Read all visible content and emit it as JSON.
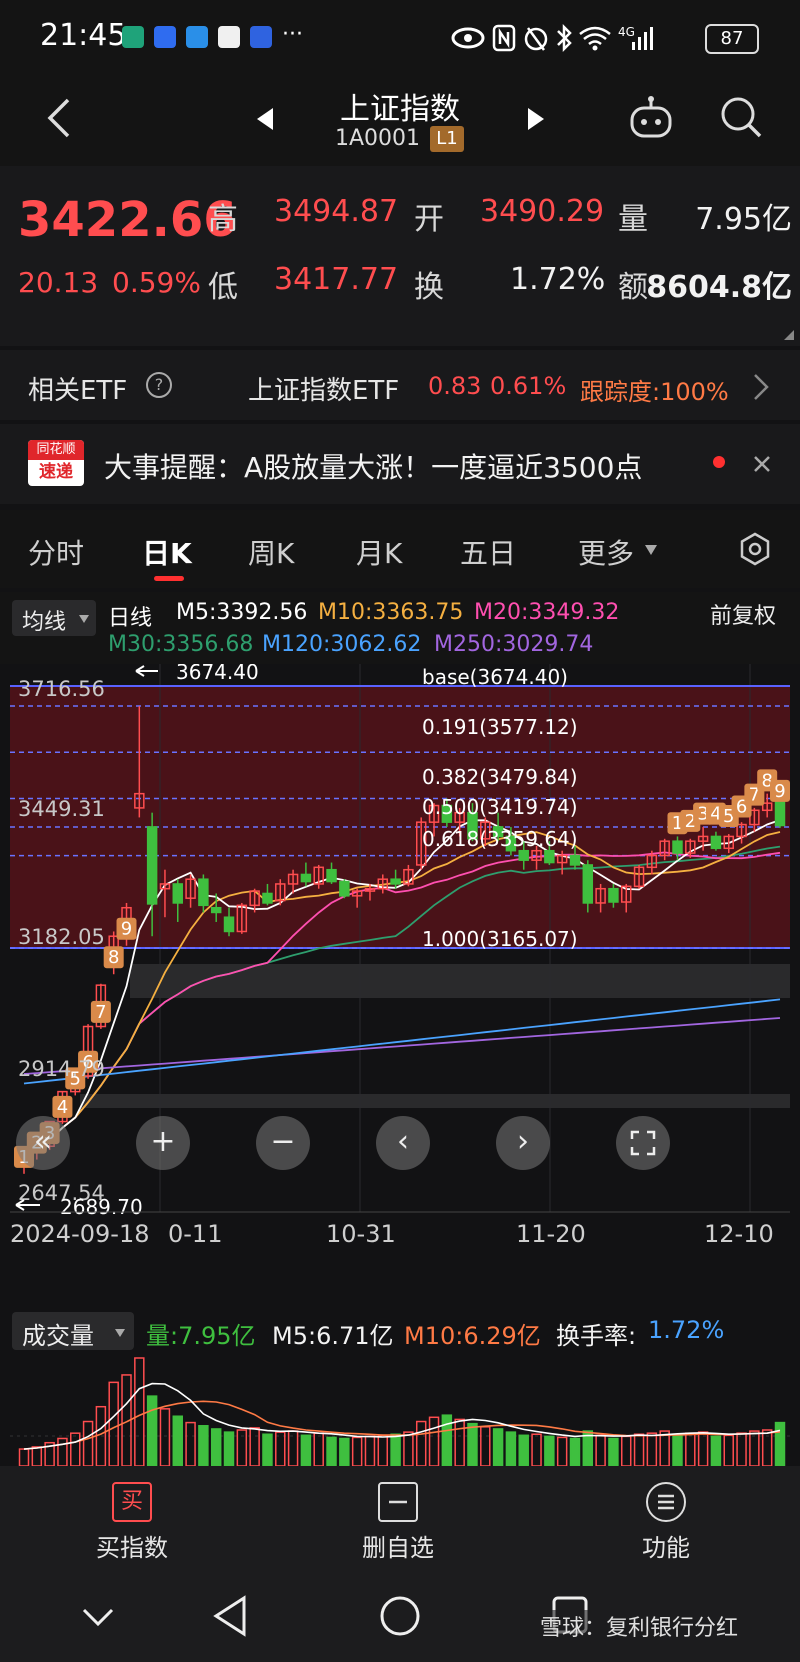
{
  "status_bar": {
    "time": "21:45",
    "dots": "···",
    "network": "4G",
    "battery": "87"
  },
  "nav": {
    "title": "上证指数",
    "code": "1A0001",
    "level_badge": "L1"
  },
  "quote": {
    "price": "3422.66",
    "change": "20.13",
    "change_pct": "0.59%",
    "high_label": "高",
    "high": "3494.87",
    "open_label": "开",
    "open": "3490.29",
    "volume_label": "量",
    "volume": "7.95亿",
    "low_label": "低",
    "low": "3417.77",
    "turnover_label": "换",
    "turnover": "1.72%",
    "amount_label": "额",
    "amount": "8604.8亿"
  },
  "etf": {
    "label": "相关ETF",
    "name": "上证指数ETF",
    "value": "0.83",
    "pct": "0.61%",
    "tracking": "跟踪度:100%"
  },
  "news": {
    "logo_top": "同花顺",
    "logo_bottom": "速递",
    "text": "大事提醒：A股放量大涨！一度逼近3500点"
  },
  "tabs": [
    "分时",
    "日K",
    "周K",
    "月K",
    "五日",
    "更多"
  ],
  "indicators": {
    "ma_selector": "均线",
    "period": "日线",
    "m5": "M5:3392.56",
    "m10": "M10:3363.75",
    "m20": "M20:3349.32",
    "m30": "M30:3356.68",
    "m120": "M120:3062.62",
    "m250": "M250:3029.74",
    "adjust": "前复权"
  },
  "colors": {
    "up": "#ff4d4f",
    "down": "#3fbf3f",
    "m5": "#ffffff",
    "m10": "#f5b041",
    "m20": "#ff4fb0",
    "m30": "#2e9f6e",
    "m120": "#4aa3ff",
    "m250": "#a266e0"
  },
  "chart_labels": {
    "top_price": "3716.56",
    "mid_price": "3449.31",
    "low_band_price": "3182.05",
    "price_2914": "2914.79",
    "bottom_price": "2647.54",
    "max_arrow": "3674.40",
    "min_arrow": "2689.70",
    "fib": [
      "base(3674.40)",
      "0.191(3577.12)",
      "0.382(3479.84)",
      "0.500(3419.74)",
      "0.618(3359.64)",
      "1.000(3165.07)"
    ],
    "dates": [
      "2024-09-18",
      "0-11",
      "10-31",
      "11-20",
      "12-10"
    ],
    "counts_early": [
      "1",
      "2",
      "3",
      "4",
      "5",
      "6",
      "7",
      "8",
      "9"
    ],
    "counts_late": [
      "1",
      "2",
      "3",
      "4",
      "5",
      "6",
      "7",
      "8",
      "9"
    ]
  },
  "chart_controls": {
    "zoom_in": "+",
    "zoom_out": "−",
    "prev": "‹",
    "next": "›"
  },
  "volume": {
    "selector": "成交量",
    "vol": "量:7.95亿",
    "m5": "M5:6.71亿",
    "m10": "M10:6.29亿",
    "turnover_label": "换手率:",
    "turnover": "1.72%"
  },
  "actions": {
    "buy_icon": "买",
    "buy": "买指数",
    "remove": "删自选",
    "func": "功能"
  },
  "watermark": "雪球：复利银行分红",
  "chart_data": {
    "type": "candlestick",
    "period": "日线",
    "x_ticks": [
      "2024-09-18",
      "10-31",
      "11-20",
      "12-10"
    ],
    "price_labels": [
      3716.56,
      3449.31,
      3182.05,
      2914.79,
      2647.54
    ],
    "max_marker": 3674.4,
    "min_marker": 2689.7,
    "fibonacci": [
      {
        "level": "base",
        "value": 3674.4
      },
      {
        "level": "0.191",
        "value": 3577.12
      },
      {
        "level": "0.382",
        "value": 3479.84
      },
      {
        "level": "0.500",
        "value": 3419.74
      },
      {
        "level": "0.618",
        "value": 3359.64
      },
      {
        "level": "1.000",
        "value": 3165.07
      }
    ],
    "ylim": [
      2647.54,
      3716.56
    ],
    "candles": [
      [
        2717,
        2736,
        2690,
        2736
      ],
      [
        2736,
        2749,
        2720,
        2748
      ],
      [
        2748,
        2800,
        2740,
        2800
      ],
      [
        2800,
        2864,
        2795,
        2863
      ],
      [
        2863,
        2900,
        2855,
        2896
      ],
      [
        2896,
        3005,
        2890,
        3000
      ],
      [
        3000,
        3090,
        2995,
        3087
      ],
      [
        3130,
        3200,
        3110,
        3190
      ],
      [
        3200,
        3260,
        3170,
        3250
      ],
      [
        3460,
        3674,
        3440,
        3490
      ],
      [
        3420,
        3450,
        3190,
        3258
      ],
      [
        3290,
        3330,
        3230,
        3300
      ],
      [
        3300,
        3310,
        3220,
        3260
      ],
      [
        3270,
        3320,
        3250,
        3310
      ],
      [
        3310,
        3320,
        3240,
        3255
      ],
      [
        3250,
        3280,
        3220,
        3240
      ],
      [
        3230,
        3250,
        3190,
        3200
      ],
      [
        3200,
        3260,
        3195,
        3255
      ],
      [
        3255,
        3290,
        3240,
        3285
      ],
      [
        3280,
        3300,
        3255,
        3260
      ],
      [
        3265,
        3310,
        3255,
        3300
      ],
      [
        3300,
        3330,
        3280,
        3320
      ],
      [
        3320,
        3345,
        3295,
        3305
      ],
      [
        3300,
        3340,
        3290,
        3335
      ],
      [
        3330,
        3345,
        3300,
        3305
      ],
      [
        3305,
        3310,
        3270,
        3275
      ],
      [
        3275,
        3290,
        3250,
        3285
      ],
      [
        3285,
        3300,
        3265,
        3290
      ],
      [
        3290,
        3320,
        3280,
        3310
      ],
      [
        3310,
        3330,
        3290,
        3300
      ],
      [
        3300,
        3340,
        3295,
        3330
      ],
      [
        3340,
        3440,
        3330,
        3430
      ],
      [
        3430,
        3470,
        3400,
        3465
      ],
      [
        3465,
        3480,
        3420,
        3430
      ],
      [
        3430,
        3460,
        3400,
        3450
      ],
      [
        3450,
        3470,
        3390,
        3395
      ],
      [
        3395,
        3440,
        3380,
        3430
      ],
      [
        3420,
        3450,
        3390,
        3400
      ],
      [
        3400,
        3420,
        3360,
        3370
      ],
      [
        3370,
        3390,
        3330,
        3350
      ],
      [
        3350,
        3380,
        3330,
        3370
      ],
      [
        3370,
        3390,
        3340,
        3345
      ],
      [
        3345,
        3370,
        3320,
        3360
      ],
      [
        3360,
        3380,
        3330,
        3340
      ],
      [
        3340,
        3350,
        3240,
        3260
      ],
      [
        3260,
        3300,
        3240,
        3290
      ],
      [
        3290,
        3300,
        3250,
        3262
      ],
      [
        3262,
        3300,
        3240,
        3295
      ],
      [
        3295,
        3340,
        3290,
        3335
      ],
      [
        3335,
        3370,
        3320,
        3360
      ],
      [
        3360,
        3395,
        3350,
        3390
      ],
      [
        3390,
        3400,
        3350,
        3365
      ],
      [
        3365,
        3395,
        3355,
        3390
      ],
      [
        3390,
        3420,
        3370,
        3400
      ],
      [
        3400,
        3410,
        3370,
        3375
      ],
      [
        3375,
        3405,
        3365,
        3400
      ],
      [
        3400,
        3430,
        3385,
        3425
      ],
      [
        3425,
        3460,
        3410,
        3455
      ],
      [
        3455,
        3490,
        3440,
        3470
      ],
      [
        3490,
        3495,
        3418,
        3423
      ]
    ],
    "volume_bars": [
      1.6,
      1.8,
      2.2,
      2.6,
      3.1,
      4.2,
      5.6,
      7.9,
      8.6,
      10.2,
      6.6,
      5.4,
      4.7,
      4.1,
      3.8,
      3.5,
      3.2,
      3.4,
      3.6,
      3.0,
      3.2,
      3.3,
      2.9,
      3.1,
      2.7,
      2.6,
      2.7,
      2.8,
      2.9,
      3.0,
      3.2,
      4.2,
      4.6,
      4.8,
      4.4,
      4.0,
      3.7,
      3.5,
      3.2,
      2.9,
      3.0,
      2.8,
      2.7,
      2.6,
      3.3,
      2.9,
      2.6,
      2.8,
      3.0,
      3.1,
      3.3,
      3.0,
      3.1,
      3.2,
      2.8,
      2.9,
      3.1,
      3.3,
      3.4,
      4.1
    ]
  }
}
